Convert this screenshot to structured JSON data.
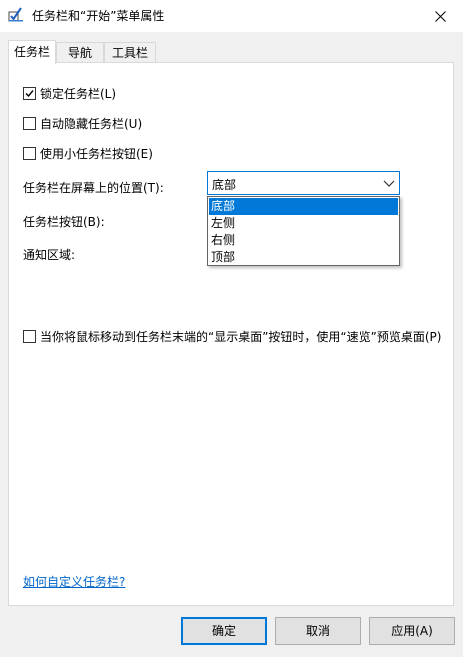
{
  "window": {
    "title": "任务栏和“开始”菜单属性"
  },
  "tabs": [
    {
      "label": "任务栏"
    },
    {
      "label": "导航"
    },
    {
      "label": "工具栏"
    }
  ],
  "taskbar": {
    "lock_label": "锁定任务栏(L)",
    "autohide_label": "自动隐藏任务栏(U)",
    "small_buttons_label": "使用小任务栏按钮(E)",
    "position_label": "任务栏在屏幕上的位置(T):",
    "position_value": "底部",
    "position_options": [
      "底部",
      "左侧",
      "右侧",
      "顶部"
    ],
    "buttons_label": "任务栏按钮(B):",
    "notification_label": "通知区域:",
    "peek_label": "当你将鼠标移动到任务栏末端的“显示桌面”按钮时，使用“速览”预览桌面(P)",
    "help_link": "如何自定义任务栏?"
  },
  "checkbox_states": {
    "lock": true,
    "autohide": false,
    "small_buttons": false,
    "peek": false
  },
  "buttons": {
    "ok": "确定",
    "cancel": "取消",
    "apply": "应用(A)"
  },
  "colors": {
    "accent": "#0078d7",
    "link": "#0066cc"
  }
}
